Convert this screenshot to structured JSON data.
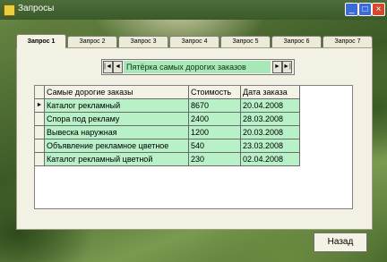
{
  "window": {
    "title": "Запросы",
    "controls": {
      "minimize": "_",
      "maximize": "□",
      "close": "×"
    }
  },
  "tabs": [
    {
      "label": "Запрос 1",
      "active": true
    },
    {
      "label": "Запрос 2",
      "active": false
    },
    {
      "label": "Запрос 3",
      "active": false
    },
    {
      "label": "Запрос 4",
      "active": false
    },
    {
      "label": "Запрос 5",
      "active": false
    },
    {
      "label": "Запрос 6",
      "active": false
    },
    {
      "label": "Запрос 7",
      "active": false
    }
  ],
  "navigator": {
    "first": "|◄",
    "prev": "◄",
    "caption": "Пятёрка самых дорогих заказов",
    "next": "►",
    "last": "►|"
  },
  "table": {
    "columns": [
      "Самые дорогие заказы",
      "Стоимость",
      "Дата заказа"
    ],
    "current_row_marker": "►",
    "rows": [
      [
        "Каталог рекламный",
        "8670",
        "20.04.2008"
      ],
      [
        "Спора под рекламу",
        "2400",
        "28.03.2008"
      ],
      [
        "Вывеска наружная",
        "1200",
        "20.03.2008"
      ],
      [
        "Объявление рекламное цветное",
        "540",
        "23.03.2008"
      ],
      [
        "Каталог рекламный цветной",
        "230",
        "02.04.2008"
      ]
    ]
  },
  "back_button": "Назад",
  "colors": {
    "grid_cell": "#b8f0c8",
    "panel": "#f2f1e3",
    "titlebar": "#3a5a2a"
  }
}
